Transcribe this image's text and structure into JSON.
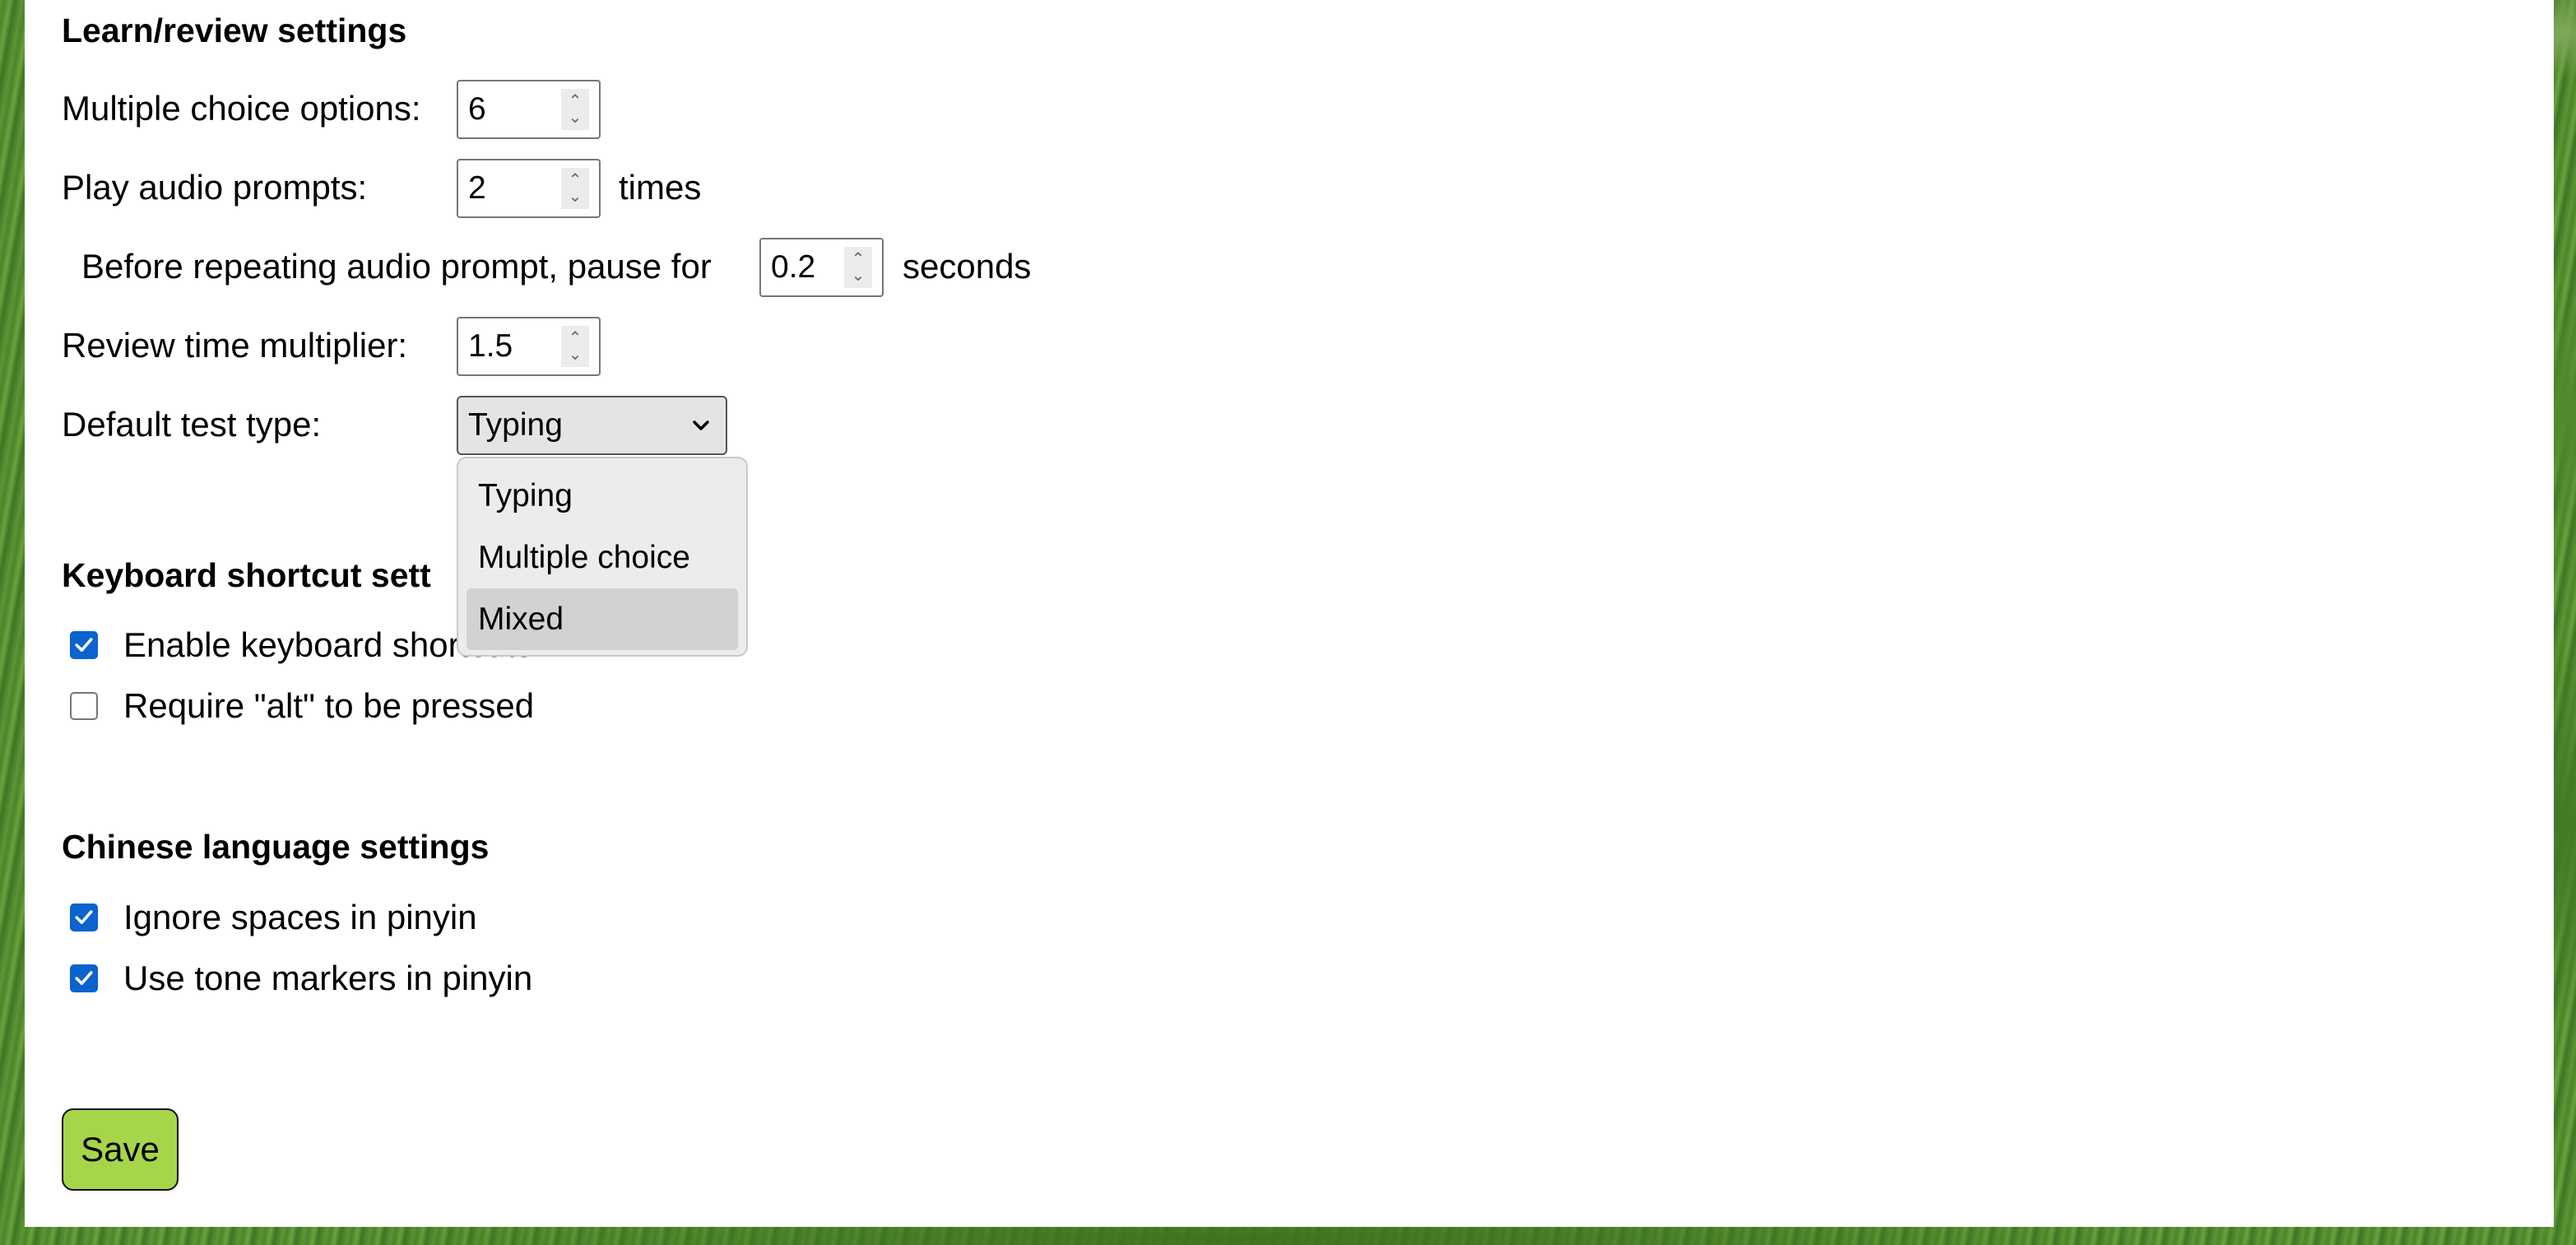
{
  "learn_review": {
    "title": "Learn/review settings",
    "multiple_choice_label": "Multiple choice options:",
    "multiple_choice_value": "6",
    "audio_prompts_label": "Play audio prompts:",
    "audio_prompts_value": "2",
    "audio_prompts_unit": "times",
    "pause_label": "Before repeating audio prompt, pause for",
    "pause_value": "0.2",
    "pause_unit": "seconds",
    "review_multiplier_label": "Review time multiplier:",
    "review_multiplier_value": "1.5",
    "test_type_label": "Default test type:",
    "test_type_selected": "Typing",
    "test_type_options": [
      "Typing",
      "Multiple choice",
      "Mixed"
    ],
    "test_type_highlighted": "Mixed"
  },
  "keyboard": {
    "title": "Keyboard shortcut sett",
    "enable_label": "Enable keyboard sho",
    "enable_label_tail": "rtcuts",
    "enable_checked": true,
    "require_alt_label": "Require \"alt\" to be pressed",
    "require_alt_checked": false
  },
  "chinese": {
    "title": "Chinese language settings",
    "ignore_spaces_label": "Ignore spaces in pinyin",
    "ignore_spaces_checked": true,
    "tone_markers_label": "Use tone markers in pinyin",
    "tone_markers_checked": true
  },
  "save_label": "Save",
  "colors": {
    "checkbox_accent": "#0b63ce",
    "save_button": "#a6d54a",
    "dropdown_highlight": "#d2d2d2"
  },
  "icons": {
    "spinner": "up-down-arrows-icon",
    "select": "chevron-down-icon",
    "checkbox": "checkmark-icon"
  }
}
